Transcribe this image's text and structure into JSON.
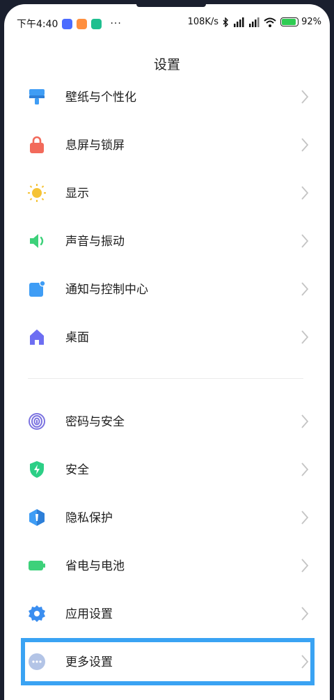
{
  "status_bar": {
    "time": "下午4:40",
    "more": "···",
    "network_speed": "108K/s",
    "battery_percent": "92%"
  },
  "header": {
    "title": "设置"
  },
  "settings_group_1": [
    {
      "label": "壁纸与个性化",
      "icon": "paintbrush-icon",
      "color": "#3f9df5"
    },
    {
      "label": "息屏与锁屏",
      "icon": "lock-icon",
      "color": "#f26a5b"
    },
    {
      "label": "显示",
      "icon": "sun-icon",
      "color": "#f5c336"
    },
    {
      "label": "声音与振动",
      "icon": "speaker-icon",
      "color": "#3dd17a"
    },
    {
      "label": "通知与控制中心",
      "icon": "notification-icon",
      "color": "#3f9df5"
    },
    {
      "label": "桌面",
      "icon": "home-icon",
      "color": "#6d6ef2"
    }
  ],
  "settings_group_2": [
    {
      "label": "密码与安全",
      "icon": "fingerprint-icon",
      "color": "#7b72e0"
    },
    {
      "label": "安全",
      "icon": "shield-bolt-icon",
      "color": "#2ccf86"
    },
    {
      "label": "隐私保护",
      "icon": "privacy-icon",
      "color": "#3f9df5"
    },
    {
      "label": "省电与电池",
      "icon": "battery-icon",
      "color": "#3dd17a"
    },
    {
      "label": "应用设置",
      "icon": "gear-icon",
      "color": "#3a8ef0"
    },
    {
      "label": "更多设置",
      "icon": "more-dots-icon",
      "color": "#b3c4e6"
    }
  ],
  "highlight_color": "#3aa3f3"
}
